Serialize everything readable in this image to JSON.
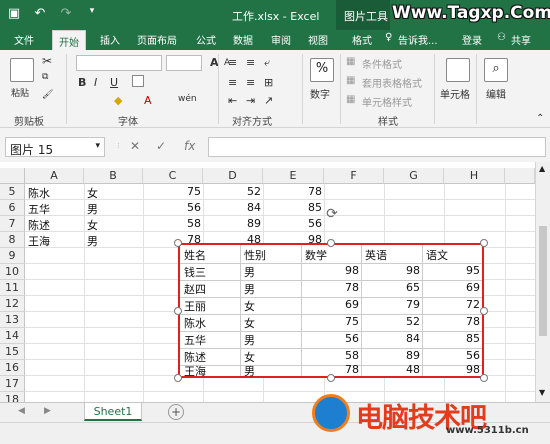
{
  "window": {
    "title": "工作.xlsx - Excel",
    "context_tab": "图片工具",
    "watermark": "Www.Tagxp.Com",
    "quick_access": {
      "save_icon": "save-icon",
      "undo_icon": "undo-icon",
      "redo_icon": "redo-icon"
    }
  },
  "ribbon_tabs": {
    "file": "文件",
    "home": "开始",
    "insert": "插入",
    "page_layout": "页面布局",
    "formulas": "公式",
    "data": "数据",
    "review": "审阅",
    "view": "视图",
    "format": "格式",
    "tell_me": "告诉我...",
    "login": "登录",
    "share": "共享"
  },
  "ribbon": {
    "clipboard": {
      "paste": "粘贴",
      "label": "剪贴板"
    },
    "font": {
      "label": "字体",
      "bold": "B",
      "italic": "I",
      "underline": "U"
    },
    "alignment": {
      "label": "对齐方式"
    },
    "number": {
      "percent": "%",
      "label": "数字"
    },
    "styles": {
      "conditional": "条件格式",
      "table": "套用表格格式",
      "cell_styles": "单元格样式",
      "label": "样式"
    },
    "cells": {
      "label": "单元格"
    },
    "editing": {
      "label": "编辑"
    }
  },
  "formula_bar": {
    "name_box": "图片 15",
    "cancel": "✕",
    "enter": "✓",
    "fx": "fx",
    "value": ""
  },
  "columns": [
    "A",
    "B",
    "C",
    "D",
    "E",
    "F",
    "G",
    "H"
  ],
  "rows": [
    "5",
    "6",
    "7",
    "8",
    "9",
    "10",
    "11",
    "12",
    "13",
    "14",
    "15",
    "16",
    "17",
    "18"
  ],
  "sheet_rows": [
    {
      "name": "陈水",
      "gender": "女",
      "c": "75",
      "d": "52",
      "e": "78"
    },
    {
      "name": "五华",
      "gender": "男",
      "c": "56",
      "d": "84",
      "e": "85"
    },
    {
      "name": "陈述",
      "gender": "女",
      "c": "58",
      "d": "89",
      "e": "56"
    },
    {
      "name": "王海",
      "gender": "男",
      "c": "78",
      "d": "48",
      "e": "98"
    }
  ],
  "picture_table": {
    "headers": [
      "姓名",
      "性别",
      "数学",
      "英语",
      "语文"
    ],
    "rows": [
      [
        "钱三",
        "男",
        "98",
        "98",
        "95"
      ],
      [
        "赵四",
        "男",
        "78",
        "65",
        "69"
      ],
      [
        "王丽",
        "女",
        "69",
        "79",
        "72"
      ],
      [
        "陈水",
        "女",
        "75",
        "52",
        "78"
      ],
      [
        "五华",
        "男",
        "56",
        "84",
        "85"
      ],
      [
        "陈述",
        "女",
        "58",
        "89",
        "56"
      ],
      [
        "王海",
        "男",
        "78",
        "48",
        "98"
      ]
    ]
  },
  "sheet_tabs": {
    "active": "Sheet1",
    "add": "+"
  },
  "overlay_logo": {
    "text": "电脑技术吧",
    "url": "www.5311b.cn"
  },
  "colors": {
    "excel_green": "#217346",
    "selection_red": "#e0201c"
  }
}
